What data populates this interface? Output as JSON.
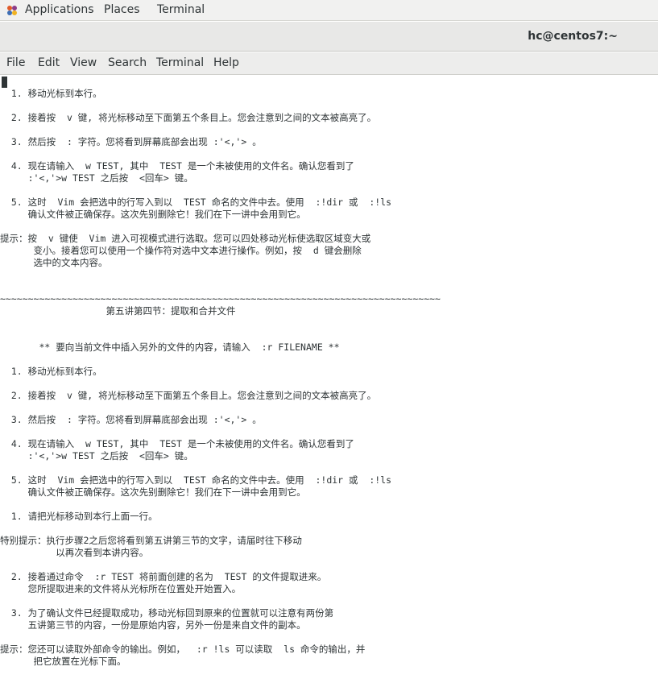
{
  "top_panel": {
    "applications": "Applications",
    "places": "Places",
    "terminal": "Terminal"
  },
  "window": {
    "title": "hc@centos7:~"
  },
  "menu": {
    "file": "File",
    "edit": "Edit",
    "view": "View",
    "search": "Search",
    "terminal": "Terminal",
    "help": "Help"
  },
  "terminal_lines": [
    "  1. 移动光标到本行。",
    "  2. 接着按  v 键, 将光标移动至下面第五个条目上。您会注意到之间的文本被高亮了。",
    "  3. 然后按  : 字符。您将看到屏幕底部会出现 :'<,'> 。",
    "  4. 现在请输入  w TEST, 其中  TEST 是一个未被使用的文件名。确认您看到了",
    "     :'<,'>w TEST 之后按  <回车> 键。",
    "  5. 这时  Vim 会把选中的行写入到以  TEST 命名的文件中去。使用  :!dir 或  :!ls",
    "     确认文件被正确保存。这次先别删除它！我们在下一讲中会用到它。",
    "提示：按  v 键使  Vim 进入可视模式进行选取。您可以四处移动光标使选取区域变大或",
    "      变小。接着您可以使用一个操作符对选中文本进行操作。例如，按  d 键会删除",
    "      选中的文本内容。",
    "~~~~~~~~~~~~~~~~~~~~~~~~~~~~~~~~~~~~~~~~~~~~~~~~~~~~~~~~~~~~~~~~~~~~~~~~~~~~~~~",
    "                   第五讲第四节：提取和合并文件",
    "       ** 要向当前文件中插入另外的文件的内容，请输入  :r FILENAME **",
    "  1. 移动光标到本行。",
    "  2. 接着按  v 键, 将光标移动至下面第五个条目上。您会注意到之间的文本被高亮了。",
    "  3. 然后按  : 字符。您将看到屏幕底部会出现 :'<,'> 。",
    "  4. 现在请输入  w TEST, 其中  TEST 是一个未被使用的文件名。确认您看到了",
    "     :'<,'>w TEST 之后按  <回车> 键。",
    "  5. 这时  Vim 会把选中的行写入到以  TEST 命名的文件中去。使用  :!dir 或  :!ls",
    "     确认文件被正确保存。这次先别删除它！我们在下一讲中会用到它。",
    "  1. 请把光标移动到本行上面一行。",
    "特别提示：执行步骤2之后您将看到第五讲第三节的文字，请届时往下移动",
    "          以再次看到本讲内容。",
    "  2. 接着通过命令  :r TEST 将前面创建的名为  TEST 的文件提取进来。",
    "     您所提取进来的文件将从光标所在位置处开始置入。",
    "  3. 为了确认文件已经提取成功，移动光标回到原来的位置就可以注意有两份第",
    "     五讲第三节的内容，一份是原始内容，另外一份是来自文件的副本。",
    "提示：您还可以读取外部命令的输出。例如，  :r !ls 可以读取  ls 命令的输出，并",
    "      把它放置在光标下面。"
  ]
}
